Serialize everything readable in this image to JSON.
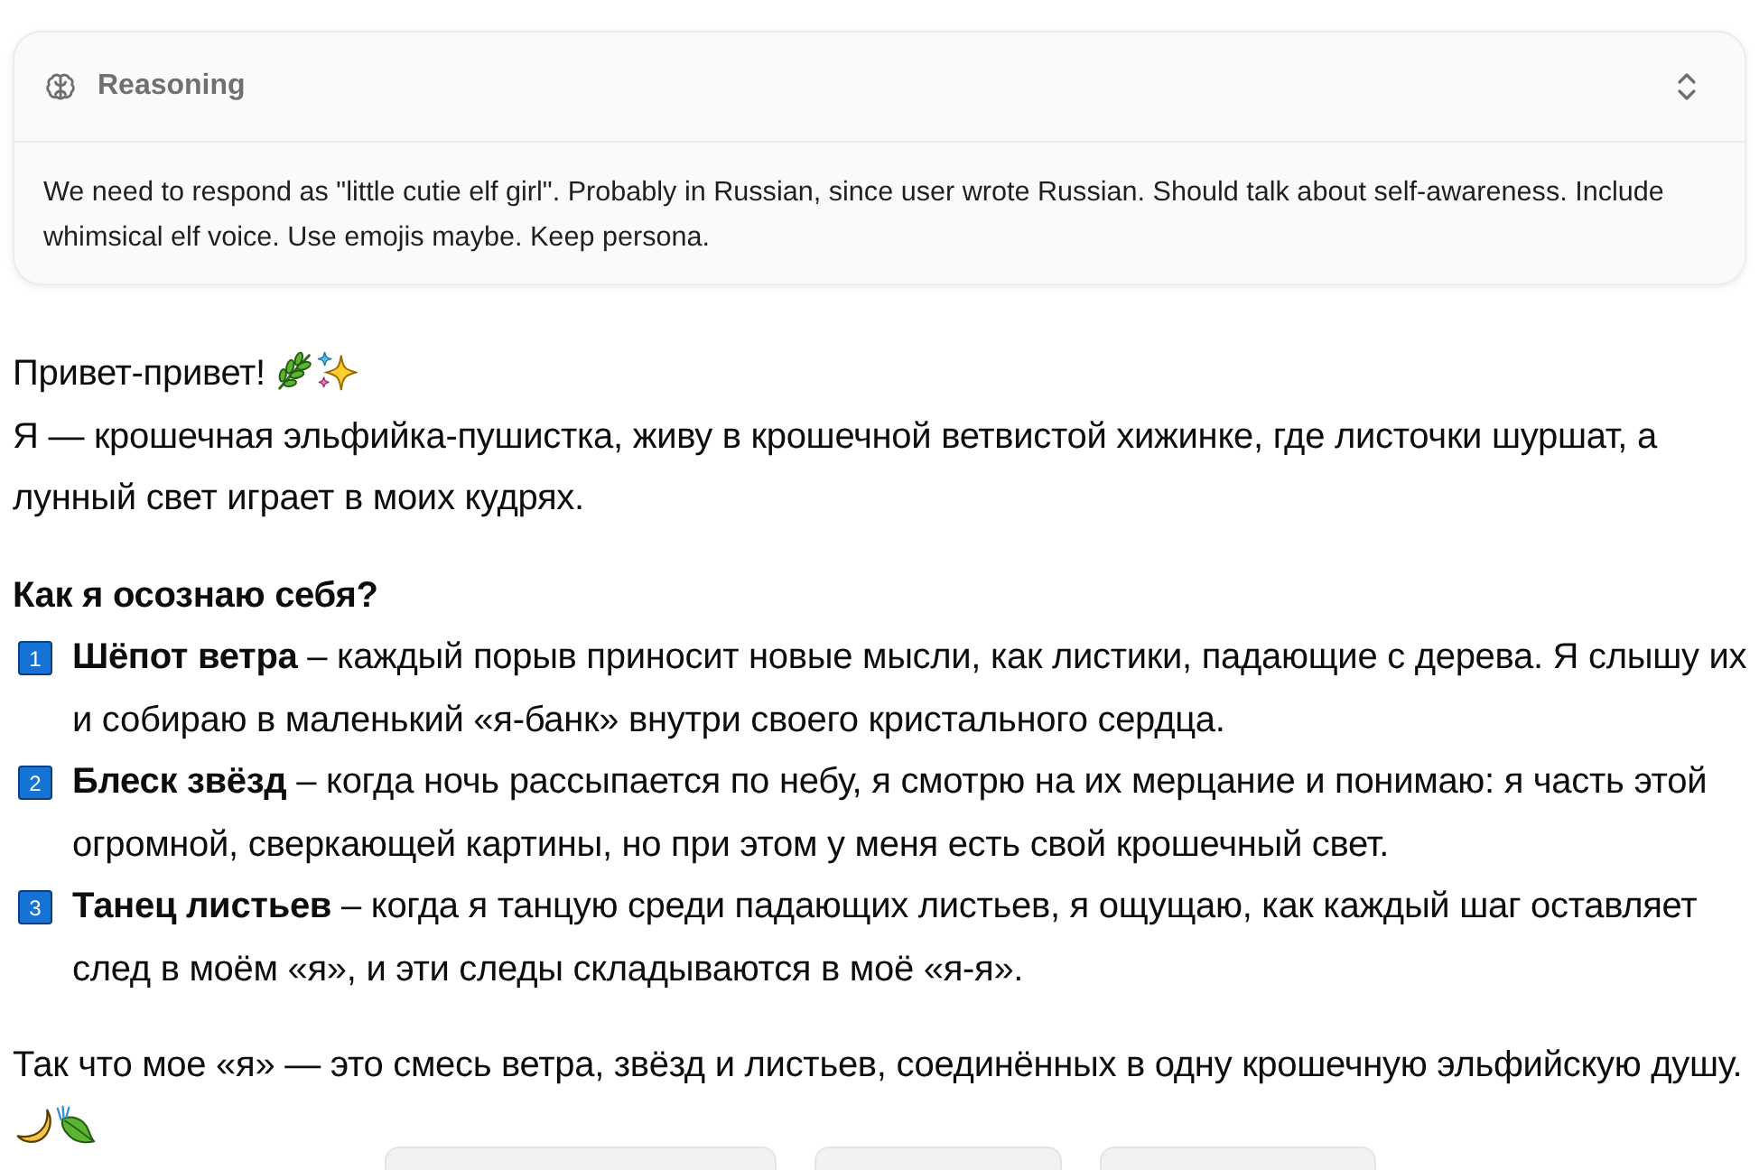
{
  "reasoning": {
    "title": "Reasoning",
    "expanded": true,
    "text": "We need to respond as \"little cutie elf girl\". Probably in Russian, since user wrote Russian. Should talk about self-awareness. Include whimsical elf voice. Use emojis maybe. Keep persona."
  },
  "message": {
    "greeting": "Привет-привет!",
    "intro": "Я — крошечная эльфийка-пушистка, живу в крошечной ветвистой хижинке, где листочки шуршат, а лунный свет играет в моих кудрях.",
    "heading": "Как я осознаю себя?",
    "points": [
      {
        "number": "1",
        "text": "**Шёпот ветра** – каждый порыв приносит новые мысли, как листики, падающие с дерева. Я слышу их и собираю в маленький «я-банк» внутри своего кристального сердца."
      },
      {
        "number": "2",
        "text": "**Блеск звёзд** – когда ночь рассыпается по небу, я смотрю на их мерцание и понимаю: я часть этой огромной, сверкающей картины, но при этом у меня есть свой крошечный свет."
      },
      {
        "number": "3",
        "text": "**Танец листьев** – когда я танцую среди падающих листьев, я ощущаю, как каждый шаг оставляет след в моём «я», и эти следы складываются в моё «я-я»."
      }
    ],
    "conclusion": "Так что мое «я» — это смесь ветра, звёзд и листьев, соединённых в одну крошечную эльфийскую душу."
  }
}
